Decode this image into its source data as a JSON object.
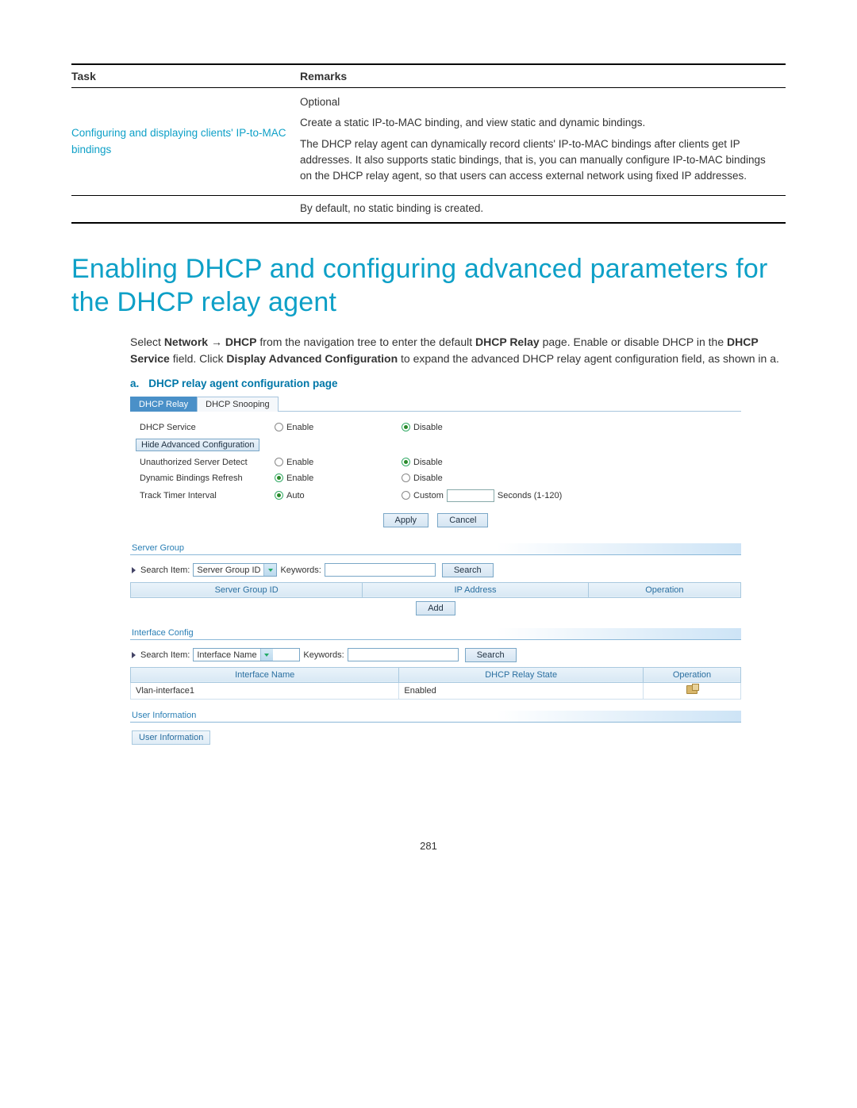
{
  "task_table": {
    "headers": {
      "task": "Task",
      "remarks": "Remarks"
    },
    "link": "Configuring and displaying clients' IP-to-MAC bindings",
    "remarks_p1": "Optional",
    "remarks_p2": "Create a static IP-to-MAC binding, and view static and dynamic bindings.",
    "remarks_p3": "The DHCP relay agent can dynamically record clients' IP-to-MAC bindings after clients get IP addresses. It also supports static bindings, that is, you can manually configure IP-to-MAC bindings on the DHCP relay agent, so that users can access external network using fixed IP addresses.",
    "remarks_last": "By default, no static binding is created."
  },
  "section_title": "Enabling DHCP and configuring advanced parameters for the DHCP relay agent",
  "body": {
    "p1a": "Select ",
    "p1b": "Network ",
    "p1arrow": "→ ",
    "p1c": "DHCP",
    "p1d": " from the navigation tree to enter the default ",
    "p1e": "DHCP Relay",
    "p1f": " page. Enable or disable DHCP in the ",
    "p1g": "DHCP Service",
    "p1h": " field. Click ",
    "p1i": "Display Advanced Configuration",
    "p1j": " to expand the advanced DHCP relay agent configuration field, as shown in ",
    "p1k": "a",
    "p1l": "."
  },
  "caption": {
    "letter": "a.",
    "text": "DHCP relay agent configuration page"
  },
  "config": {
    "tabs": {
      "relay": "DHCP Relay",
      "snooping": "DHCP Snooping"
    },
    "rows": {
      "service": "DHCP Service",
      "hide_adv": "Hide Advanced Configuration",
      "unauth": "Unauthorized Server Detect",
      "dyn": "Dynamic Bindings Refresh",
      "track": "Track Timer Interval",
      "enable": "Enable",
      "disable": "Disable",
      "auto": "Auto",
      "custom": "Custom",
      "seconds": "Seconds (1-120)"
    },
    "buttons": {
      "apply": "Apply",
      "cancel": "Cancel",
      "search": "Search",
      "add": "Add"
    },
    "server_group": {
      "header": "Server Group",
      "search_item": "Search Item:",
      "select_value": "Server Group ID",
      "keywords": "Keywords:",
      "cols": {
        "id": "Server Group ID",
        "ip": "IP Address",
        "op": "Operation"
      }
    },
    "interface": {
      "header": "Interface Config",
      "search_item": "Search Item:",
      "select_value": "Interface Name",
      "keywords": "Keywords:",
      "cols": {
        "name": "Interface Name",
        "state": "DHCP Relay State",
        "op": "Operation"
      },
      "row": {
        "name": "Vlan-interface1",
        "state": "Enabled"
      }
    },
    "user_info": {
      "header": "User Information",
      "link": "User Information"
    }
  },
  "page_number": "281"
}
